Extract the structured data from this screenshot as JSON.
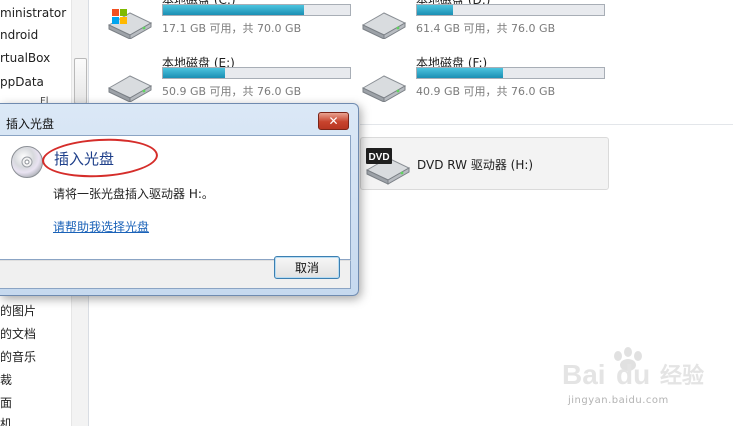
{
  "nav": {
    "items": [
      {
        "label": "ministrator"
      },
      {
        "label": "ndroid"
      },
      {
        "label": "rtualBox"
      },
      {
        "label": "ppData"
      },
      {
        "label": "的图片"
      },
      {
        "label": "的文档"
      },
      {
        "label": "的音乐"
      },
      {
        "label": "裁"
      },
      {
        "label": "面"
      },
      {
        "label": "机"
      }
    ],
    "partial_label": "Fl"
  },
  "drives": [
    {
      "name": "本地磁盘 (C:)",
      "free_text": "17.1 GB 可用，共 70.0 GB",
      "used_fraction": 0.756,
      "icon": "windows-hard-disk-icon"
    },
    {
      "name": "本地磁盘 (D:)",
      "free_text": "61.4 GB 可用，共 76.0 GB",
      "used_fraction": 0.192,
      "icon": "hard-disk-icon"
    },
    {
      "name": "本地磁盘 (E:)",
      "free_text": "50.9 GB 可用，共 76.0 GB",
      "used_fraction": 0.33,
      "icon": "hard-disk-icon"
    },
    {
      "name": "本地磁盘 (F:)",
      "free_text": "40.9 GB 可用，共 76.0 GB",
      "used_fraction": 0.462,
      "icon": "hard-disk-icon"
    }
  ],
  "dvd_drive": {
    "label": "DVD RW 驱动器 (H:)",
    "icon_text": "DVD"
  },
  "dialog": {
    "title": "插入光盘",
    "close_label": "✕",
    "heading": "插入光盘",
    "message": "请将一张光盘插入驱动器 H:。",
    "help_link": "请帮助我选择光盘",
    "cancel_label": "取消"
  },
  "watermark": {
    "brand": "Bai",
    "brand_right": "经验",
    "url": "jingyan.baidu.com"
  },
  "colors": {
    "drive_bar_fill": "#1b8fb4",
    "dialog_heading": "#1e3f8a",
    "link": "#1a62b8",
    "annotation_circle": "#d52d2a",
    "close_button": "#c7432d"
  }
}
